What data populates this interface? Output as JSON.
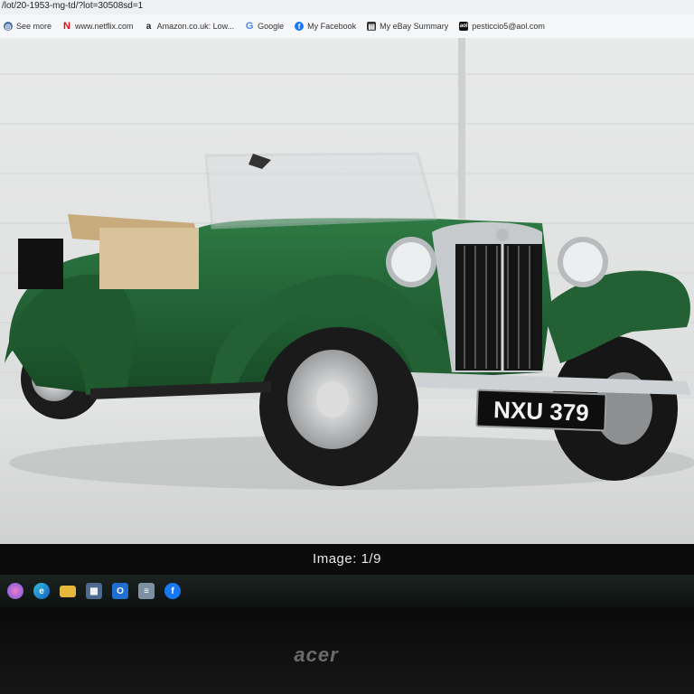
{
  "browser": {
    "url": "/lot/20-1953-mg-td/?lot=30508sd=1",
    "bookmarks": [
      {
        "label": "See more",
        "icon": "globe-icon",
        "color": "#4a6fa5"
      },
      {
        "label": "www.netflix.com",
        "icon": "netflix-icon",
        "color": "#e50914"
      },
      {
        "label": "Amazon.co.uk: Low...",
        "icon": "amazon-icon",
        "color": "#222222"
      },
      {
        "label": "Google",
        "icon": "google-icon",
        "color": "#4285f4"
      },
      {
        "label": "My Facebook",
        "icon": "facebook-icon",
        "color": "#1877f2"
      },
      {
        "label": "My eBay Summary",
        "icon": "ebay-icon",
        "color": "#333333"
      },
      {
        "label": "pesticcio5@aol.com",
        "icon": "aol-icon",
        "color": "#111111"
      }
    ]
  },
  "photo": {
    "plate": "NXU 379",
    "car_color": "#1f5a2e"
  },
  "gallery": {
    "caption": "Image: 1/9"
  },
  "taskbar": {
    "icons": [
      {
        "name": "copilot-icon",
        "glyph": "◐",
        "color": "#c04fc0"
      },
      {
        "name": "edge-icon",
        "glyph": "e",
        "color": "#1a8fd6"
      },
      {
        "name": "file-explorer-icon",
        "glyph": "▬",
        "color": "#e6b73a"
      },
      {
        "name": "store-icon",
        "glyph": "▦",
        "color": "#5a6f8a"
      },
      {
        "name": "outlook-icon",
        "glyph": "O",
        "color": "#1f6fd0"
      },
      {
        "name": "notepad-icon",
        "glyph": "≡",
        "color": "#7d8fa3"
      },
      {
        "name": "facebook-taskbar-icon",
        "glyph": "f",
        "color": "#1877f2"
      }
    ]
  },
  "monitor": {
    "brand": "acer"
  }
}
